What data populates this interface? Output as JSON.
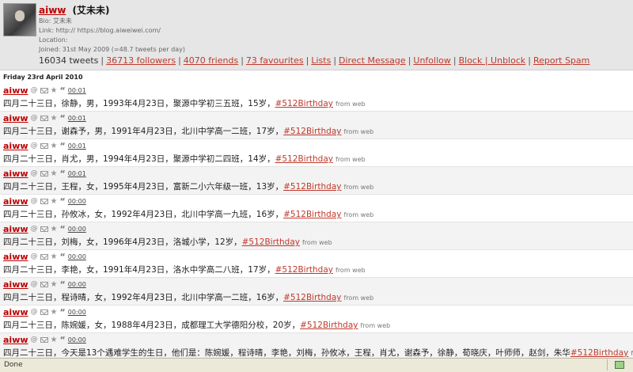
{
  "profile": {
    "username": "aiww",
    "display_name": "(艾未未)",
    "bio": "Bio: 艾未未",
    "link": "Link: http:// https://blog.aiweiwei.com/",
    "location": "Location:",
    "joined": "Joined: 31st May 2009 (=48.7 tweets per day)",
    "tweets": "16034 tweets",
    "links": [
      "36713 followers",
      "4070 friends",
      "73 favourites",
      "Lists",
      "Direct Message",
      "Unfollow",
      "Block | Unblock",
      "Report Spam"
    ]
  },
  "day_header": "Friday 23rd April 2010",
  "tweets": [
    {
      "user": "aiww",
      "time": "00:01",
      "pre": "四月二十三日，徐静，男，1993年4月23日，聚源中学初三五班，15岁，",
      "tag": "#512Birthday",
      "source": "from web"
    },
    {
      "user": "aiww",
      "time": "00:01",
      "pre": "四月二十三日，谢森予，男，1991年4月23日，北川中学高一二班，17岁，",
      "tag": "#512Birthday",
      "source": "from web"
    },
    {
      "user": "aiww",
      "time": "00:01",
      "pre": "四月二十三日，肖尤，男，1994年4月23日，聚源中学初二四班，14岁，",
      "tag": "#512Birthday",
      "source": "from web"
    },
    {
      "user": "aiww",
      "time": "00:01",
      "pre": "四月二十三日，王程，女，1995年4月23日，富新二小六年级一班，13岁，",
      "tag": "#512Birthday",
      "source": "from web"
    },
    {
      "user": "aiww",
      "time": "00:00",
      "pre": "四月二十三日，孙攸冰，女，1992年4月23日，北川中学高一九班，16岁，",
      "tag": "#512Birthday",
      "source": "from web"
    },
    {
      "user": "aiww",
      "time": "00:00",
      "pre": "四月二十三日，刘梅，女，1996年4月23日，洛城小学，12岁，",
      "tag": "#512Birthday",
      "source": "from web"
    },
    {
      "user": "aiww",
      "time": "00:00",
      "pre": "四月二十三日，李艳，女，1991年4月23日，洛水中学高二八班，17岁，",
      "tag": "#512Birthday",
      "source": "from web"
    },
    {
      "user": "aiww",
      "time": "00:00",
      "pre": "四月二十三日，程诗晴，女，1992年4月23日，北川中学高一二班，16岁，",
      "tag": "#512Birthday",
      "source": "from web"
    },
    {
      "user": "aiww",
      "time": "00:00",
      "pre": "四月二十三日，陈婉媛，女，1988年4月23日，成都理工大学德阳分校，20岁，",
      "tag": "#512Birthday",
      "source": "from web"
    },
    {
      "user": "aiww",
      "time": "00:00",
      "pre": "四月二十三日，今天是13个遇难学生的生日，他们是：陈婉媛，程诗晴，李艳，刘梅，孙攸冰，王程，肖尤，谢森予，徐静，荀晓庆，叶师师，赵剑，朱华",
      "tag": "#512Birthday",
      "source": "from web"
    }
  ],
  "status_bar": "Done"
}
